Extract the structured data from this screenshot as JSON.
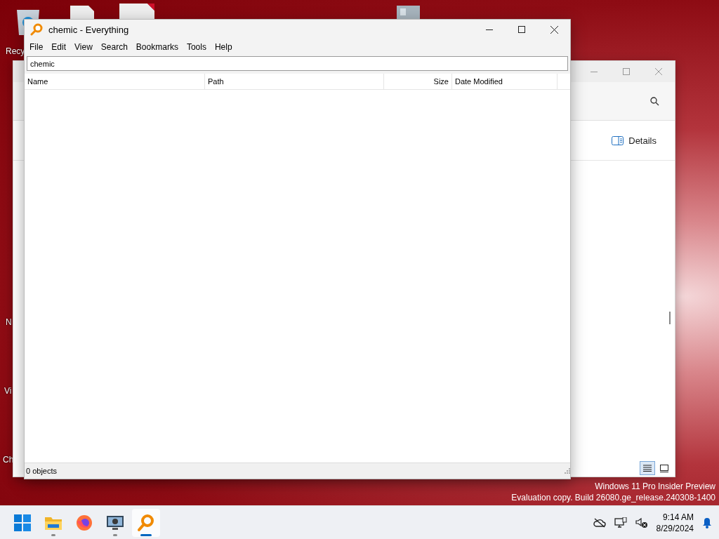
{
  "desktop": {
    "icons": [
      {
        "label": "Recy"
      },
      {
        "label": "N"
      },
      {
        "label": "Vi"
      },
      {
        "label": "Ch"
      }
    ]
  },
  "explorer_window": {
    "details_button": "Details",
    "view_buttons": [
      {
        "kind": "details",
        "selected": true
      },
      {
        "kind": "tiles",
        "selected": false
      }
    ]
  },
  "window": {
    "title": "chemic - Everything",
    "menu": [
      "File",
      "Edit",
      "View",
      "Search",
      "Bookmarks",
      "Tools",
      "Help"
    ],
    "search": {
      "value": "chemic"
    },
    "columns": [
      {
        "label": "Name",
        "kind": "text"
      },
      {
        "label": "Path",
        "kind": "text"
      },
      {
        "label": "Size",
        "kind": "number"
      },
      {
        "label": "Date Modified",
        "kind": "text"
      }
    ],
    "status_bar": "0 objects"
  },
  "watermark": [
    "Windows 11 Pro Insider Preview",
    "Evaluation copy. Build 26080.ge_release.240308-1400"
  ],
  "taskbar": {
    "apps": [
      {
        "kind": "start",
        "running": false,
        "selected": false
      },
      {
        "kind": "folder",
        "running": true,
        "selected": false
      },
      {
        "kind": "firefox",
        "running": false,
        "selected": false
      },
      {
        "kind": "monitor",
        "running": true,
        "selected": false
      },
      {
        "kind": "everything",
        "running": true,
        "selected": true
      }
    ],
    "clock": {
      "time": "9:14 AM",
      "date": "8/29/2024"
    }
  }
}
